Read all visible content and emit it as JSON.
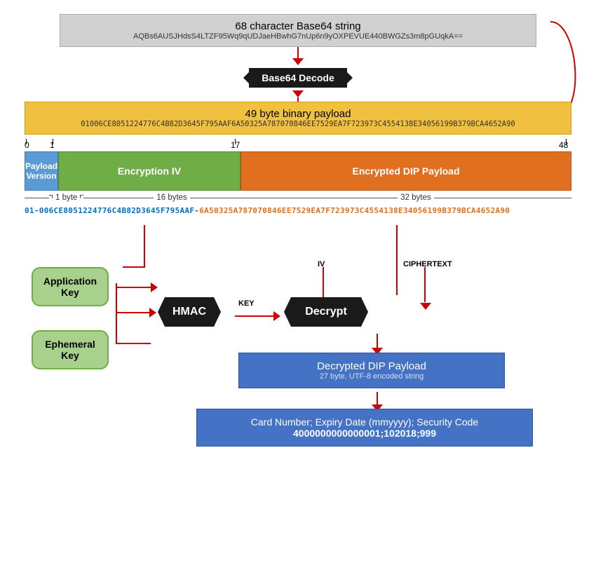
{
  "top": {
    "title": "68 character Base64 string",
    "value": "AQBs6AUSJHdsS4LTZF95Wq9qUDJaeHBwhG7nUp6n9yOXPEVUE440BWGZs3m8pGUqkA=="
  },
  "decode": {
    "label": "Base64 Decode"
  },
  "binary": {
    "title": "49 byte binary payload",
    "value": "01006CE8051224776C4B82D3645F795AAF6A50325A787070846EE7529EA7F723973C4554138E34056199B379BCA4652A90"
  },
  "markers": {
    "m0": "0",
    "m1": "1",
    "m17": "17",
    "m48": "48"
  },
  "segments": {
    "version": "Payload\nVersion",
    "iv": "Encryption IV",
    "payload": "Encrypted DIP Payload"
  },
  "byteLabels": {
    "b1": "1 byte",
    "b16": "16 bytes",
    "b32": "32 bytes"
  },
  "hexString": {
    "blue_part": "01-006CE8051224776C4B82D3645F795AAF-",
    "orange_part": "6A50325A787070846EE7529EA7F723973C4554138E34056199B379BCA4652A90"
  },
  "keys": {
    "application": "Application\nKey",
    "ephemeral": "Ephemeral\nKey"
  },
  "hmac": {
    "label": "HMAC"
  },
  "decrypt": {
    "label": "Decrypt"
  },
  "labels": {
    "iv": "IV",
    "key": "KEY",
    "ciphertext": "CIPHERTEXT"
  },
  "decryptedPayload": {
    "title": "Decrypted DIP Payload",
    "subtitle": "27 byte, UTF-8 encoded string"
  },
  "cardData": {
    "title": "Card Number; Expiry Date (mmyyyy); Security Code",
    "value": "4000000000000001;102018;999"
  }
}
